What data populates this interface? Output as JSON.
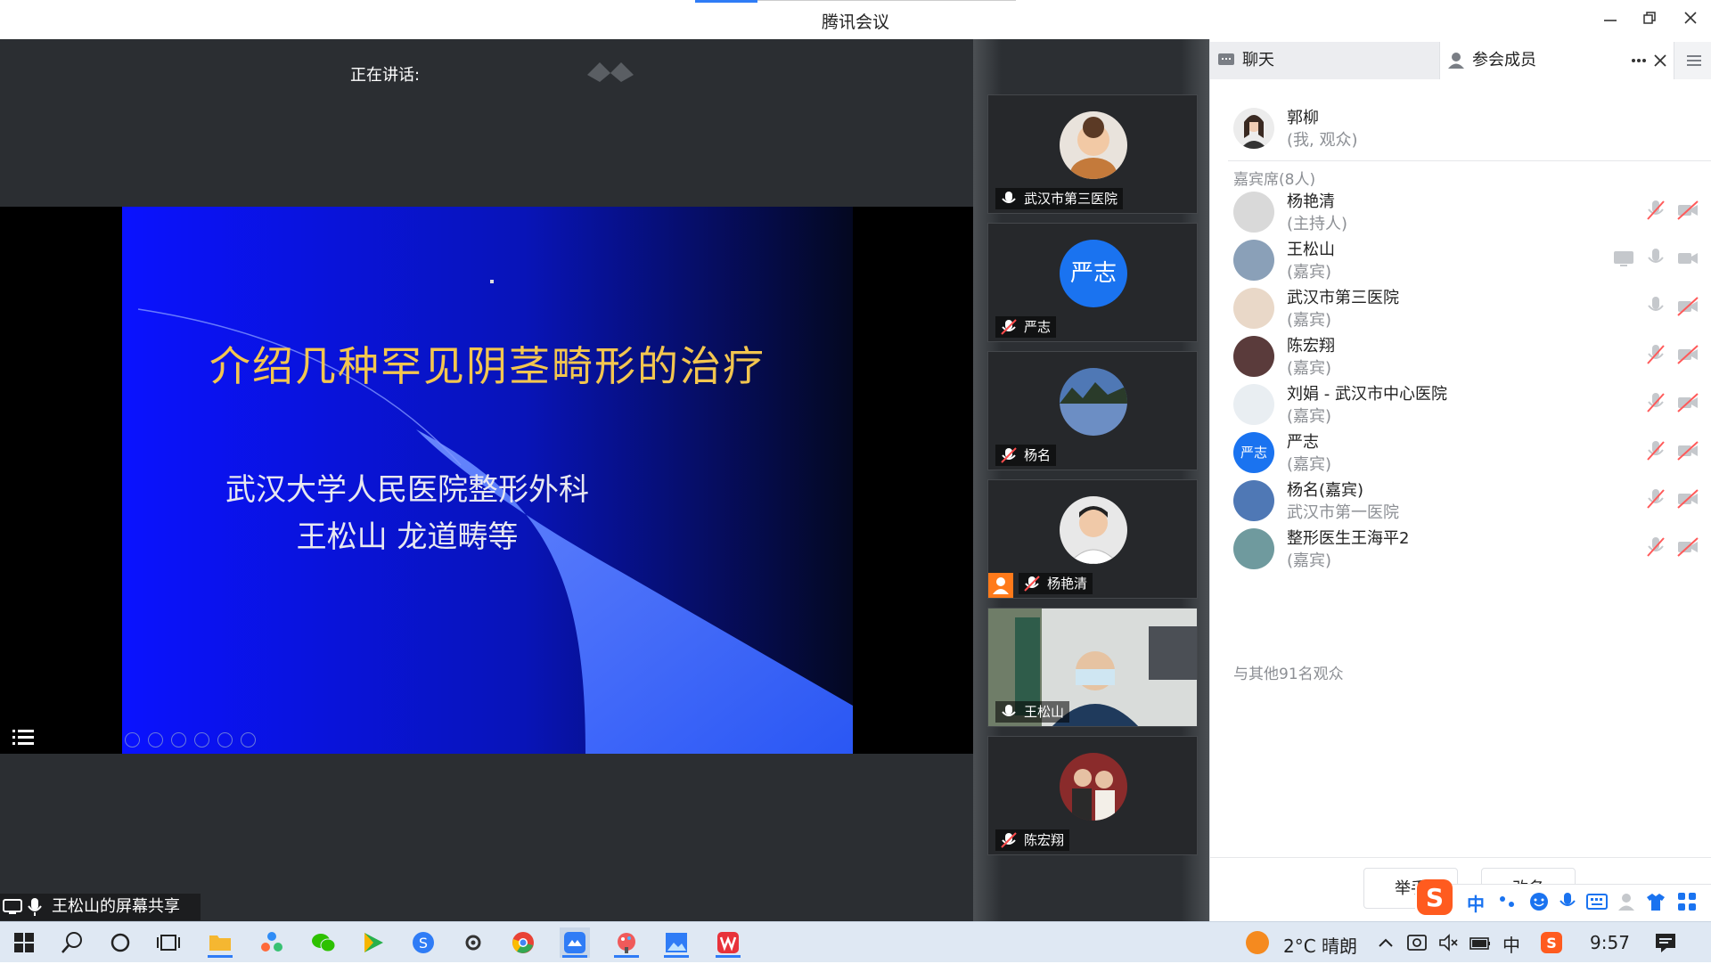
{
  "window": {
    "title": "腾讯会议"
  },
  "stage": {
    "speaking_label": "正在讲话:",
    "slide": {
      "title": "介绍几种罕见阴茎畸形的治疗",
      "subtitle_line1": "武汉大学人民医院整形外科",
      "subtitle_line2": "王松山  龙道畴等"
    },
    "share_label": "王松山的屏幕共享"
  },
  "gallery": [
    {
      "name": "武汉市第三医院",
      "mic": "on",
      "avatar": "baby-photo"
    },
    {
      "name": "严志",
      "mic": "muted",
      "avatar": "initials",
      "initials": "严志",
      "avatar_color": "#1a73f0"
    },
    {
      "name": "杨名",
      "mic": "muted",
      "avatar": "landscape-photo"
    },
    {
      "name": "杨艳清",
      "mic": "muted",
      "avatar": "man-photo",
      "host_badge": true
    },
    {
      "name": "王松山",
      "mic": "on",
      "avatar": "video-feed"
    },
    {
      "name": "陈宏翔",
      "mic": "muted",
      "avatar": "couple-photo"
    }
  ],
  "panel": {
    "tab_chat": "聊天",
    "tab_members": "参会成员",
    "self": {
      "name": "郭柳",
      "role": "(我, 观众)"
    },
    "guest_section": "嘉宾席(8人)",
    "members": [
      {
        "name": "杨艳清",
        "role": "(主持人)",
        "mic": "muted",
        "cam": "off",
        "screen": false
      },
      {
        "name": "王松山",
        "role": "(嘉宾)",
        "mic": "on",
        "cam": "on",
        "screen": true
      },
      {
        "name": "武汉市第三医院",
        "role": "(嘉宾)",
        "mic": "on",
        "cam": "off",
        "screen": false
      },
      {
        "name": "陈宏翔",
        "role": "(嘉宾)",
        "mic": "muted",
        "cam": "off",
        "screen": false
      },
      {
        "name": "刘娟 - 武汉市中心医院",
        "role": "(嘉宾)",
        "mic": "muted",
        "cam": "off",
        "screen": false
      },
      {
        "name": "严志",
        "role": "(嘉宾)",
        "mic": "muted",
        "cam": "off",
        "screen": false
      },
      {
        "name": "杨名(嘉宾)",
        "role": "武汉市第一医院",
        "mic": "muted",
        "cam": "off",
        "screen": false
      },
      {
        "name": "整形医生王海平2",
        "role": "(嘉宾)",
        "mic": "muted",
        "cam": "off",
        "screen": false
      }
    ],
    "audience_note": "与其他91名观众",
    "bottom_buttons": [
      "举手",
      "改名"
    ]
  },
  "ime_bar": {
    "mode": "中"
  },
  "taskbar": {
    "weather": "2°C  晴朗",
    "ime_indicator": "中",
    "clock": "9:57"
  }
}
